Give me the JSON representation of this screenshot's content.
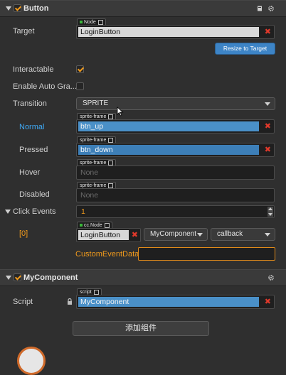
{
  "button_section": {
    "title": "Button",
    "target": {
      "label": "Target",
      "type_tag": "Node",
      "value": "LoginButton",
      "resize_button": "Resize to Target"
    },
    "interactable_label": "Interactable",
    "auto_gray_label": "Enable Auto Gra...",
    "transition": {
      "label": "Transition",
      "value": "SPRITE"
    },
    "normal": {
      "label": "Normal",
      "tag": "sprite-frame",
      "value": "btn_up"
    },
    "pressed": {
      "label": "Pressed",
      "tag": "sprite-frame",
      "value": "btn_down"
    },
    "hover": {
      "label": "Hover",
      "tag": "sprite-frame",
      "value": "None"
    },
    "disabled": {
      "label": "Disabled",
      "tag": "sprite-frame",
      "value": "None"
    },
    "click_events": {
      "label": "Click Events",
      "count": "1",
      "index_label": "[0]",
      "node_tag": "cc.Node",
      "node_value": "LoginButton",
      "component": "MyComponent",
      "handler": "callback",
      "custom_label": "CustomEventData",
      "custom_value": ""
    }
  },
  "my_component_section": {
    "title": "MyComponent",
    "script": {
      "label": "Script",
      "tag": "script",
      "value": "MyComponent"
    }
  },
  "add_component_button": "添加组件",
  "colors": {
    "accent": "#f29b1c",
    "blue_label": "#3fa9f5",
    "selection": "#4a90c8",
    "remove": "#e0392b"
  }
}
